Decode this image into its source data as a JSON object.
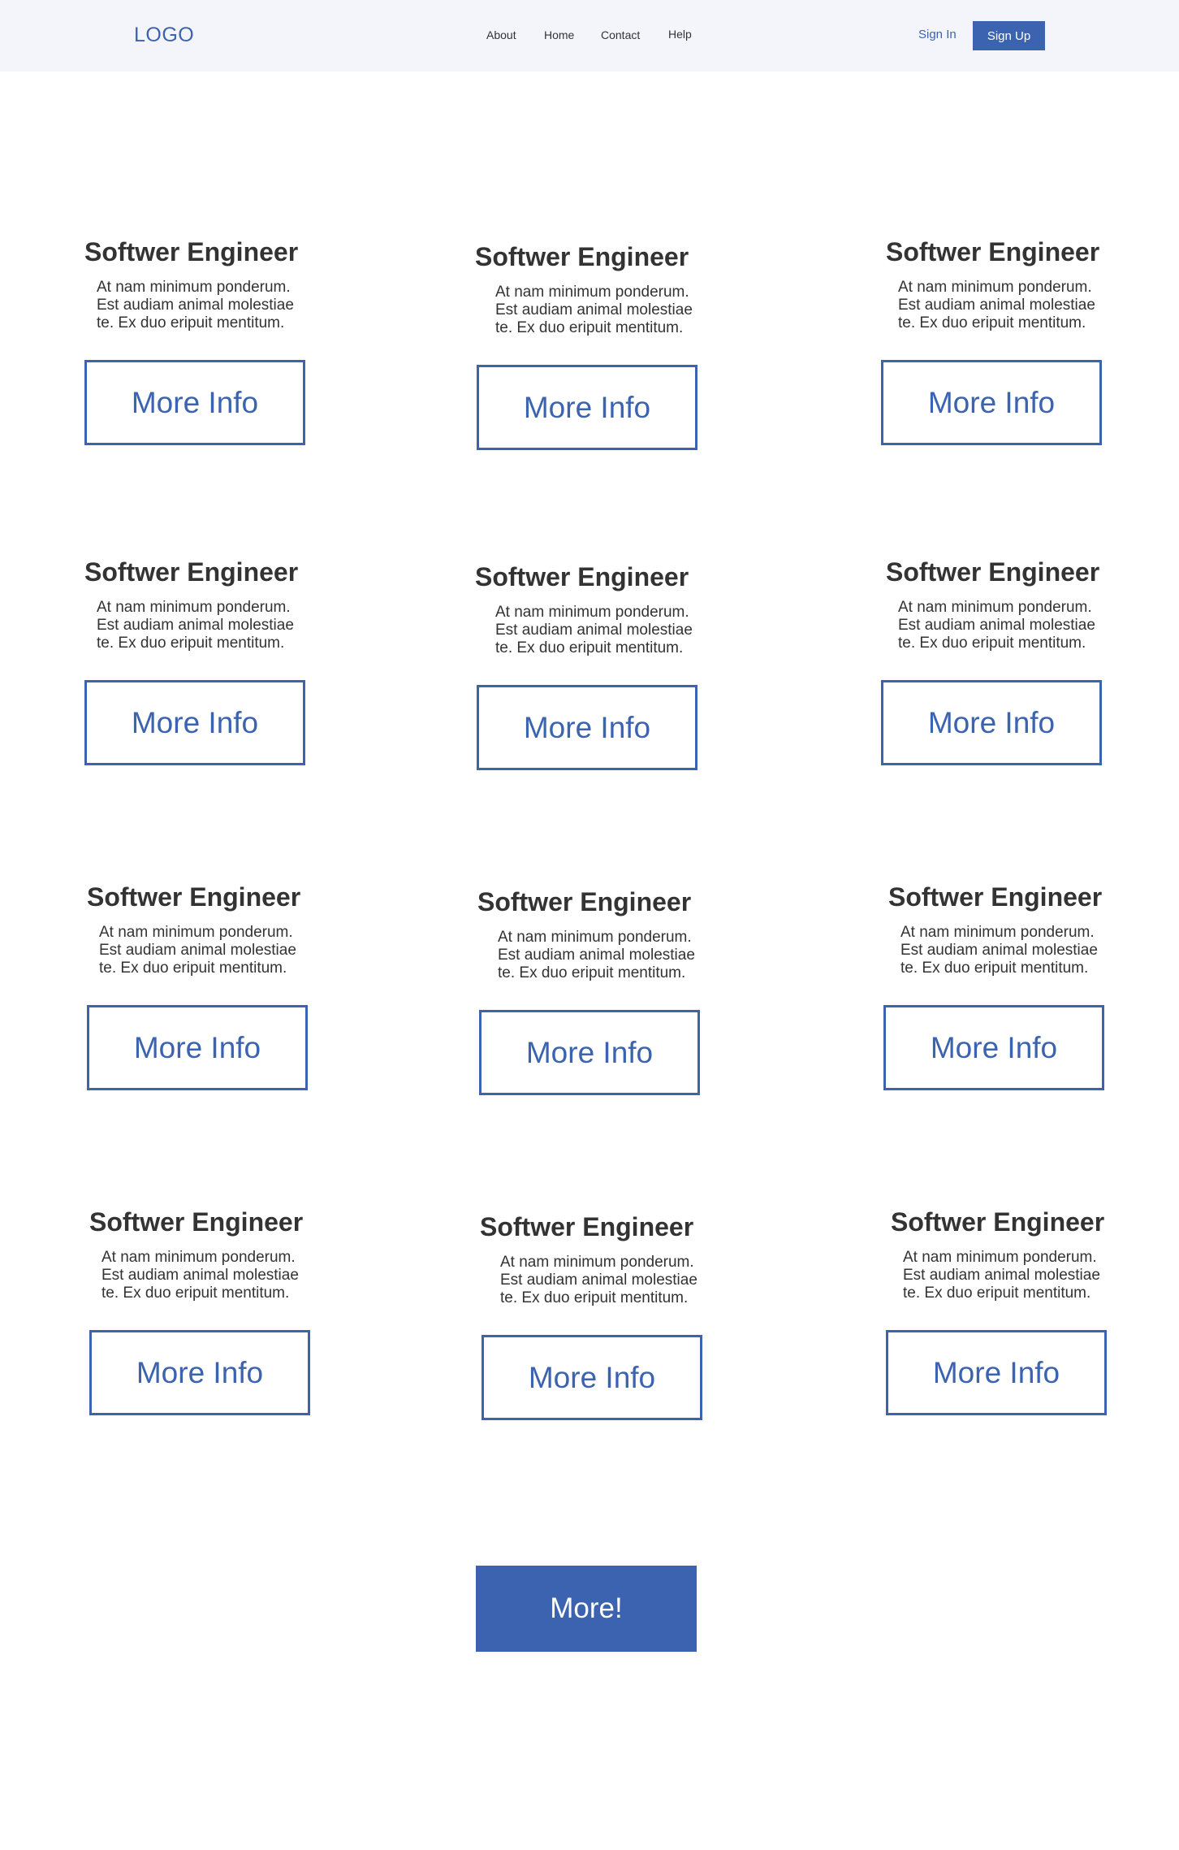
{
  "header": {
    "logo": "LOGO",
    "nav": [
      "About",
      "Home",
      "Contact",
      "Help"
    ],
    "sign_in": "Sign In",
    "sign_up": "Sign Up"
  },
  "cards": [
    {
      "title": "Softwer Engineer",
      "text": "At nam minimum ponderum. Est audiam animal molestiae te. Ex duo eripuit mentitum.",
      "button": "More Info"
    },
    {
      "title": "Softwer Engineer",
      "text": "At nam minimum ponderum. Est audiam animal molestiae te. Ex duo eripuit mentitum.",
      "button": "More Info"
    },
    {
      "title": "Softwer Engineer",
      "text": "At nam minimum ponderum. Est audiam animal molestiae te. Ex duo eripuit mentitum.",
      "button": "More Info"
    },
    {
      "title": "Softwer Engineer",
      "text": "At nam minimum ponderum. Est audiam animal molestiae te. Ex duo eripuit mentitum.",
      "button": "More Info"
    },
    {
      "title": "Softwer Engineer",
      "text": "At nam minimum ponderum. Est audiam animal molestiae te. Ex duo eripuit mentitum.",
      "button": "More Info"
    },
    {
      "title": "Softwer Engineer",
      "text": "At nam minimum ponderum. Est audiam animal molestiae te. Ex duo eripuit mentitum.",
      "button": "More Info"
    },
    {
      "title": "Softwer Engineer",
      "text": "At nam minimum ponderum. Est audiam animal molestiae te. Ex duo eripuit mentitum.",
      "button": "More Info"
    },
    {
      "title": "Softwer Engineer",
      "text": "At nam minimum ponderum. Est audiam animal molestiae te. Ex duo eripuit mentitum.",
      "button": "More Info"
    },
    {
      "title": "Softwer Engineer",
      "text": "At nam minimum ponderum. Est audiam animal molestiae te. Ex duo eripuit mentitum.",
      "button": "More Info"
    },
    {
      "title": "Softwer Engineer",
      "text": "At nam minimum ponderum. Est audiam animal molestiae te. Ex duo eripuit mentitum.",
      "button": "More Info"
    },
    {
      "title": "Softwer Engineer",
      "text": "At nam minimum ponderum. Est audiam animal molestiae te. Ex duo eripuit mentitum.",
      "button": "More Info"
    },
    {
      "title": "Softwer Engineer",
      "text": "At nam minimum ponderum. Est audiam animal molestiae te. Ex duo eripuit mentitum.",
      "button": "More Info"
    }
  ],
  "more_button": "More!",
  "colors": {
    "accent": "#3b63b0",
    "header_bg": "#f4f5fa",
    "text": "#333333"
  }
}
